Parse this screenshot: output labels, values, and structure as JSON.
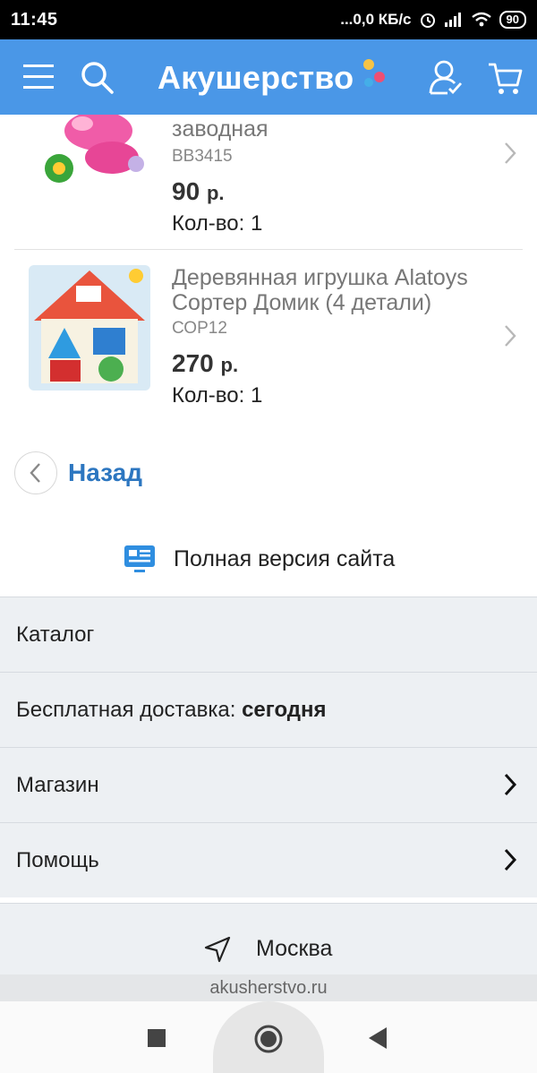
{
  "status_bar": {
    "time": "11:45",
    "network": "...0,0 КБ/с",
    "battery": "90"
  },
  "header": {
    "logo": "Акушерство",
    "icons": [
      "menu-icon",
      "search-icon",
      "user-icon",
      "cart-icon"
    ],
    "accent_color": "#4a97e7"
  },
  "products": [
    {
      "name_line2": "заводная",
      "sku": "BB3415",
      "price": "90",
      "currency": "р.",
      "qty": "Кол-во: 1"
    },
    {
      "name_line1": "Деревянная игрушка Alatoys",
      "name_line2": "Сортер Домик (4 детали)",
      "sku": "СОР12",
      "price": "270",
      "currency": "р.",
      "qty": "Кол-во: 1"
    }
  ],
  "back_label": "Назад",
  "full_version_label": "Полная версия сайта",
  "menu": {
    "catalog": "Каталог",
    "delivery_prefix": "Бесплатная доставка: ",
    "delivery_value": "сегодня",
    "store": "Магазин",
    "help": "Помощь"
  },
  "city": "Москва",
  "url": "akusherstvo.ru"
}
